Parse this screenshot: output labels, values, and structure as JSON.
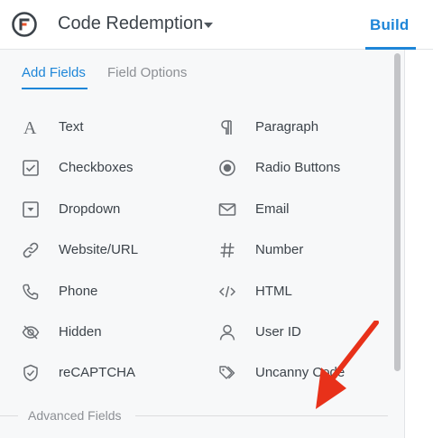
{
  "header": {
    "title": "Code Redemption",
    "active_tab": "Build"
  },
  "panel": {
    "tabs": [
      {
        "label": "Add Fields",
        "active": true
      },
      {
        "label": "Field Options",
        "active": false
      }
    ],
    "fields": [
      {
        "label": "Text",
        "icon": "text-icon"
      },
      {
        "label": "Paragraph",
        "icon": "paragraph-icon"
      },
      {
        "label": "Checkboxes",
        "icon": "checkbox-icon"
      },
      {
        "label": "Radio Buttons",
        "icon": "radio-icon"
      },
      {
        "label": "Dropdown",
        "icon": "dropdown-icon"
      },
      {
        "label": "Email",
        "icon": "email-icon"
      },
      {
        "label": "Website/URL",
        "icon": "link-icon"
      },
      {
        "label": "Number",
        "icon": "hash-icon"
      },
      {
        "label": "Phone",
        "icon": "phone-icon"
      },
      {
        "label": "HTML",
        "icon": "code-icon"
      },
      {
        "label": "Hidden",
        "icon": "eye-off-icon"
      },
      {
        "label": "User ID",
        "icon": "user-icon"
      },
      {
        "label": "reCAPTCHA",
        "icon": "shield-icon"
      },
      {
        "label": "Uncanny Code",
        "icon": "tag-icon"
      }
    ],
    "advanced_label": "Advanced Fields"
  },
  "colors": {
    "accent": "#1e86d8",
    "logo_orange": "#e8542c",
    "arrow_red": "#e8311a"
  }
}
